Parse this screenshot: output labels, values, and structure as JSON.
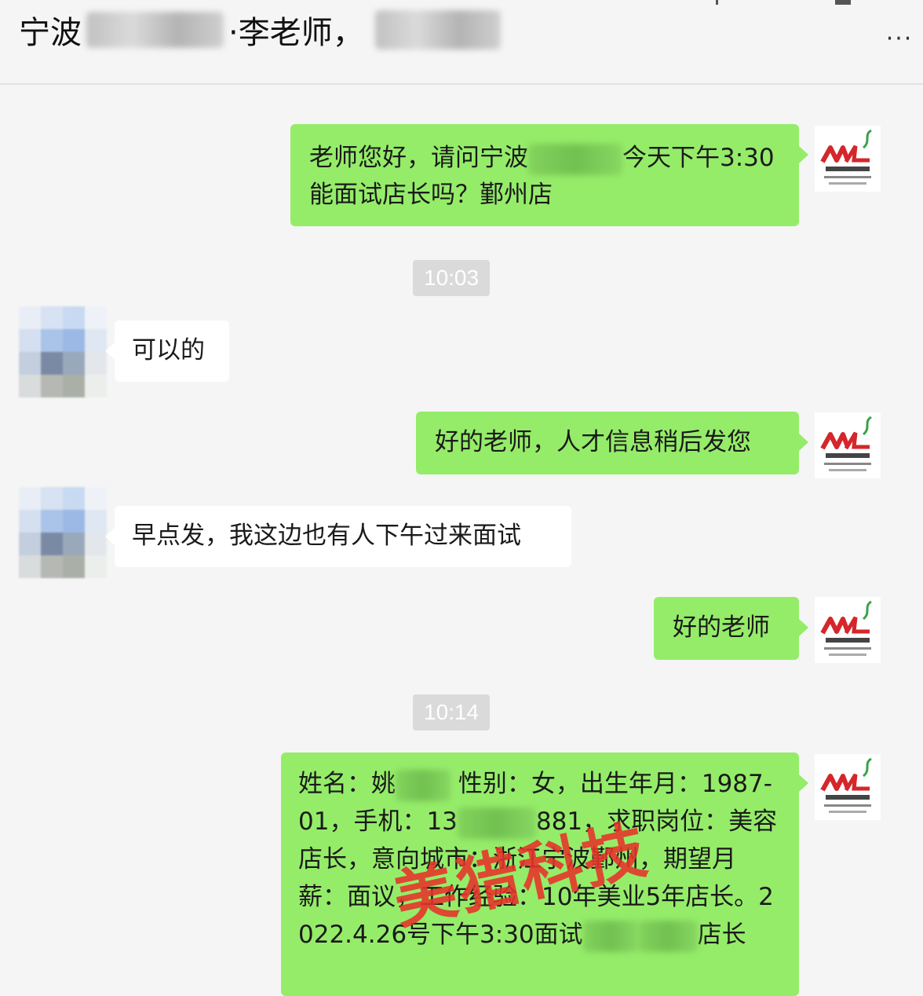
{
  "header": {
    "title_part1": "宁波",
    "title_part2": "·李老师，",
    "more_label": "···"
  },
  "messages": {
    "m1_part1": "老师您好，请问宁波",
    "m1_part2": "今天下午3:30能面试店长吗？鄞州店",
    "t1": "10:03",
    "m2": "可以的",
    "m3": "好的老师，人才信息稍后发您",
    "m4": "早点发，我这边也有人下午过来面试",
    "m5": "好的老师",
    "t2": "10:14",
    "m6_part1": "姓名：姚",
    "m6_part2": " 性别：女，出生年月：1987-01，手机：13",
    "m6_part3": "881，求职岗位：美容店长，意向城市：浙江宁波鄞州，期望月薪：面议，工作经验：10年美业5年店长。2022.4.26号下午3:30面试",
    "m6_part4": "店长"
  },
  "watermark": "美猎科技",
  "colors": {
    "self_bubble": "#95ec69",
    "other_bubble": "#ffffff",
    "background": "#f5f5f5",
    "watermark": "#e8322a"
  }
}
